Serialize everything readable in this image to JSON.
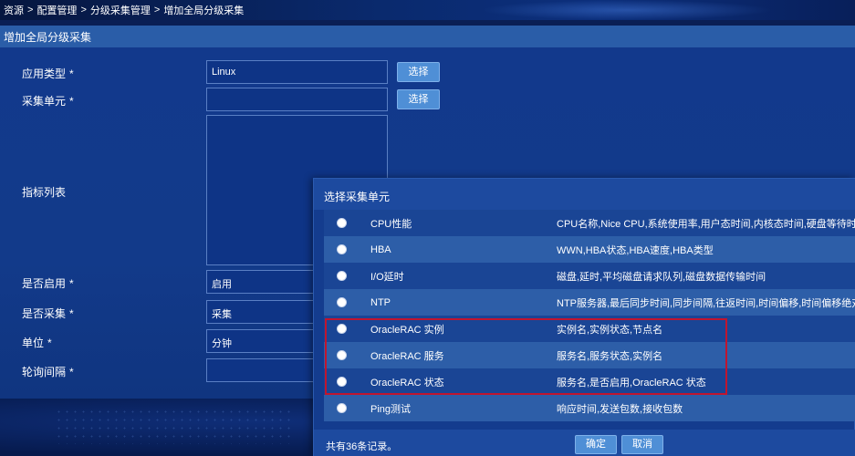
{
  "breadcrumb": {
    "items": [
      "资源",
      "配置管理",
      "分级采集管理",
      "增加全局分级采集"
    ],
    "separator": ">"
  },
  "page_title": "增加全局分级采集",
  "form": {
    "required_mark": "*",
    "app_type": {
      "label": "应用类型",
      "value": "Linux",
      "button": "选择"
    },
    "collect_unit": {
      "label": "采集单元",
      "value": "",
      "button": "选择"
    },
    "metric_list": {
      "label": "指标列表"
    },
    "enabled": {
      "label": "是否启用",
      "value": "启用"
    },
    "collect": {
      "label": "是否采集",
      "value": "采集"
    },
    "unit": {
      "label": "单位",
      "value": "分钟"
    },
    "poll_interval": {
      "label": "轮询间隔",
      "value": ""
    }
  },
  "dialog": {
    "title": "选择采集单元",
    "rows": [
      {
        "name": "CPU性能",
        "desc": "CPU名称,Nice CPU,系统使用率,用户态时间,内核态时间,硬盘等待时间,..."
      },
      {
        "name": "HBA",
        "desc": "WWN,HBA状态,HBA速度,HBA类型"
      },
      {
        "name": "I/O延时",
        "desc": "磁盘,延时,平均磁盘请求队列,磁盘数据传输时间"
      },
      {
        "name": "NTP",
        "desc": "NTP服务器,最后同步时间,同步间隔,往返时间,时间偏移,时间偏移绝对值"
      },
      {
        "name": "OracleRAC 实例",
        "desc": "实例名,实例状态,节点名"
      },
      {
        "name": "OracleRAC 服务",
        "desc": "服务名,服务状态,实例名"
      },
      {
        "name": "OracleRAC 状态",
        "desc": "服务名,是否启用,OracleRAC 状态"
      },
      {
        "name": "Ping测试",
        "desc": "响应时间,发送包数,接收包数"
      }
    ],
    "footer_count": "共有36条记录。",
    "confirm": "确定",
    "cancel": "取消"
  },
  "colors": {
    "highlight_border": "#c0152f",
    "button": "#4f8fd6",
    "panel": "#12398c"
  }
}
